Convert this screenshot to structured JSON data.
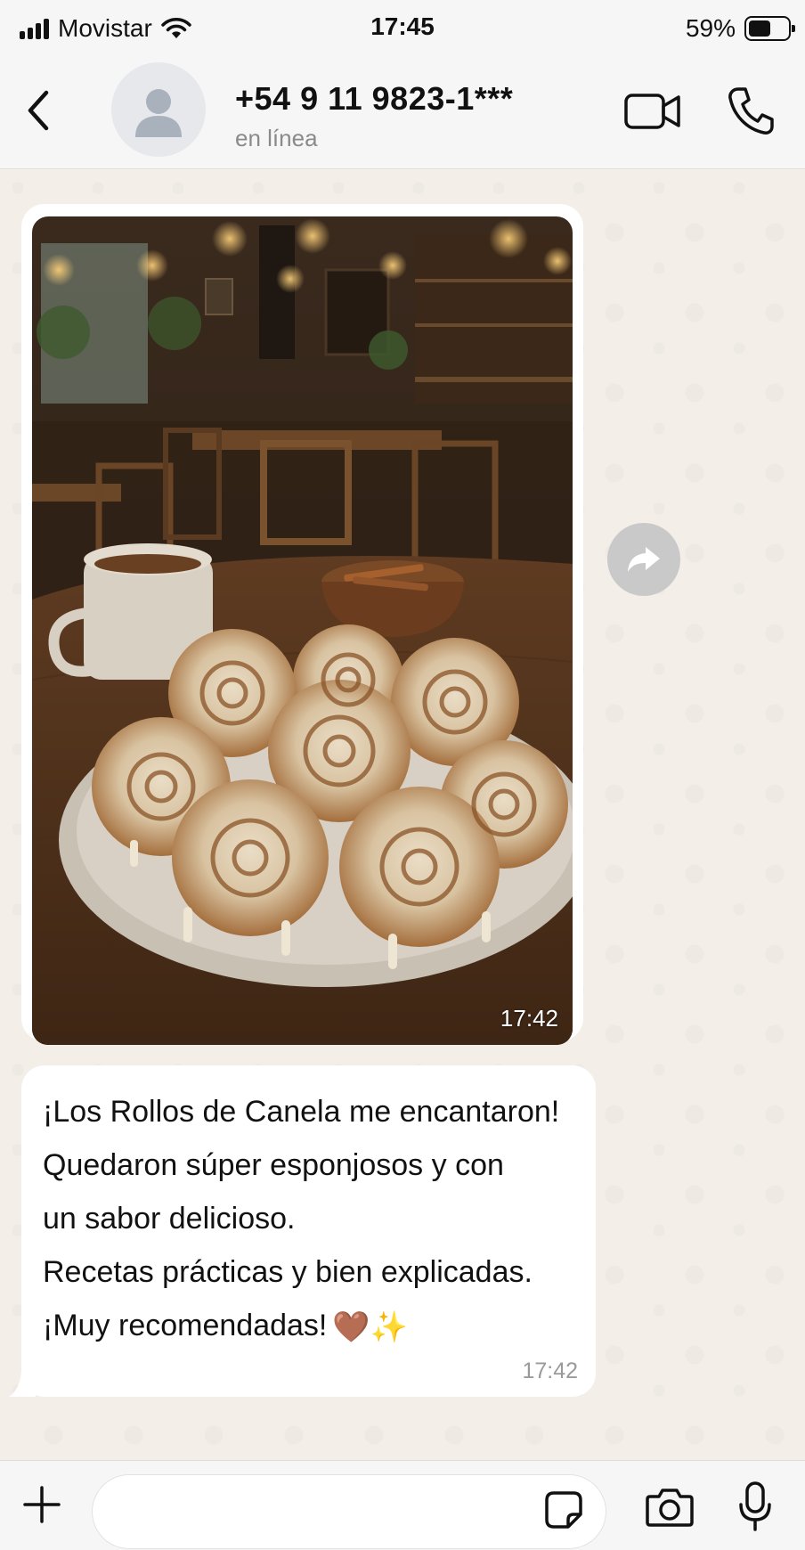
{
  "status_bar": {
    "carrier": "Movistar",
    "time": "17:45",
    "battery_percent": "59%",
    "battery_level": 0.59,
    "signal_bars": 4
  },
  "header": {
    "contact_name": "+54 9 11 9823-1***",
    "contact_status": "en línea",
    "icons": [
      "back-chevron",
      "avatar-placeholder",
      "video-camera",
      "phone"
    ]
  },
  "messages": [
    {
      "type": "image",
      "time": "17:42",
      "image_description_icon": "photo"
    },
    {
      "type": "text",
      "lines": [
        "¡Los Rollos de Canela me encantaron!",
        "Quedaron súper esponjosos y con",
        "un sabor delicioso.",
        "Recetas prácticas y bien explicadas.",
        "¡Muy recomendadas!"
      ],
      "emojis": "🤎✨",
      "time": "17:42"
    }
  ],
  "input_bar": {
    "placeholder": "",
    "icons": [
      "plus",
      "sticker",
      "camera",
      "microphone"
    ]
  },
  "colors": {
    "chat_background": "#f3efe8",
    "bar_background": "#f6f6f6",
    "bubble": "#ffffff",
    "forward_button": "#c9c9c9"
  }
}
